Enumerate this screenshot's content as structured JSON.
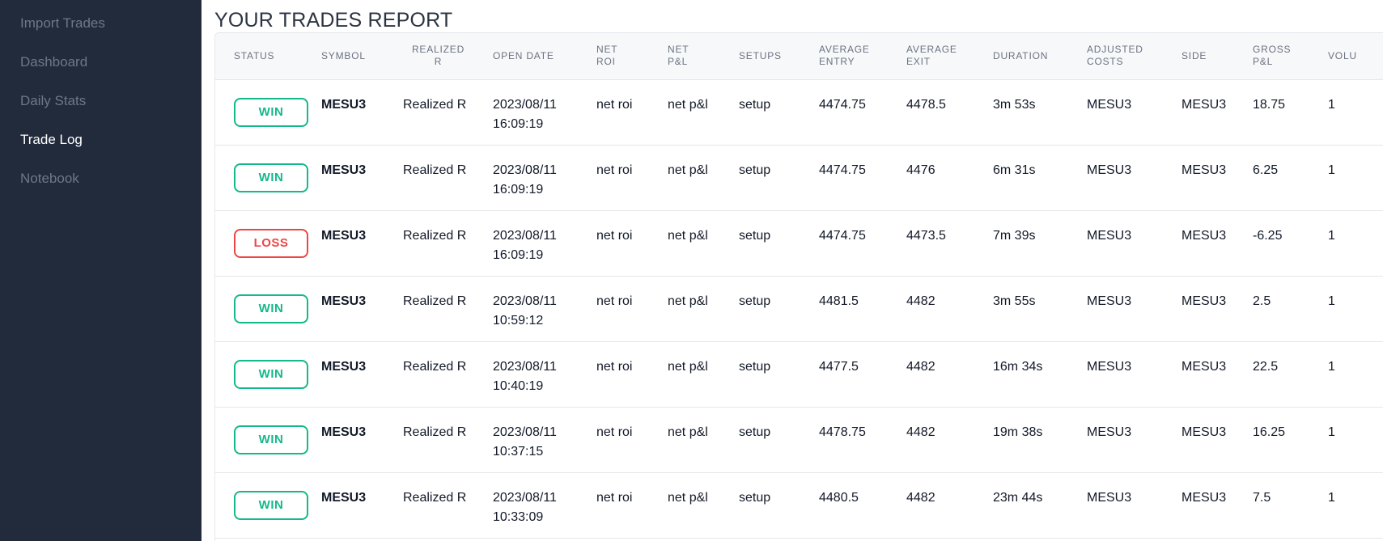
{
  "sidebar": {
    "items": [
      {
        "label": "Import Trades",
        "active": false
      },
      {
        "label": "Dashboard",
        "active": false
      },
      {
        "label": "Daily Stats",
        "active": false
      },
      {
        "label": "Trade Log",
        "active": true
      },
      {
        "label": "Notebook",
        "active": false
      }
    ]
  },
  "page": {
    "title": "YOUR TRADES REPORT"
  },
  "table": {
    "headers": {
      "status": "STATUS",
      "symbol": "SYMBOL",
      "realized_r_1": "REALIZED",
      "realized_r_2": "R",
      "open_date": "OPEN DATE",
      "net_roi_1": "NET",
      "net_roi_2": "ROI",
      "net_pl_1": "NET",
      "net_pl_2": "P&L",
      "setups": "SETUPS",
      "avg_entry_1": "AVERAGE",
      "avg_entry_2": "ENTRY",
      "avg_exit_1": "AVERAGE",
      "avg_exit_2": "EXIT",
      "duration": "DURATION",
      "adjusted_costs_1": "ADJUSTED",
      "adjusted_costs_2": "COSTS",
      "side": "SIDE",
      "gross_pl_1": "GROSS",
      "gross_pl_2": "P&L",
      "volume": "VOLU"
    },
    "rows": [
      {
        "status": "WIN",
        "symbol": "MESU3",
        "realized_r": "Realized R",
        "date": "2023/08/11",
        "time": "16:09:19",
        "net_roi": "net roi",
        "net_pl": "net p&l",
        "setup": "setup",
        "avg_entry": "4474.75",
        "avg_exit": "4478.5",
        "duration": "3m 53s",
        "adjusted_costs": "MESU3",
        "side": "MESU3",
        "gross_pl": "18.75",
        "volume": "1"
      },
      {
        "status": "WIN",
        "symbol": "MESU3",
        "realized_r": "Realized R",
        "date": "2023/08/11",
        "time": "16:09:19",
        "net_roi": "net roi",
        "net_pl": "net p&l",
        "setup": "setup",
        "avg_entry": "4474.75",
        "avg_exit": "4476",
        "duration": "6m 31s",
        "adjusted_costs": "MESU3",
        "side": "MESU3",
        "gross_pl": "6.25",
        "volume": "1"
      },
      {
        "status": "LOSS",
        "symbol": "MESU3",
        "realized_r": "Realized R",
        "date": "2023/08/11",
        "time": "16:09:19",
        "net_roi": "net roi",
        "net_pl": "net p&l",
        "setup": "setup",
        "avg_entry": "4474.75",
        "avg_exit": "4473.5",
        "duration": "7m 39s",
        "adjusted_costs": "MESU3",
        "side": "MESU3",
        "gross_pl": "-6.25",
        "volume": "1"
      },
      {
        "status": "WIN",
        "symbol": "MESU3",
        "realized_r": "Realized R",
        "date": "2023/08/11",
        "time": "10:59:12",
        "net_roi": "net roi",
        "net_pl": "net p&l",
        "setup": "setup",
        "avg_entry": "4481.5",
        "avg_exit": "4482",
        "duration": "3m 55s",
        "adjusted_costs": "MESU3",
        "side": "MESU3",
        "gross_pl": "2.5",
        "volume": "1"
      },
      {
        "status": "WIN",
        "symbol": "MESU3",
        "realized_r": "Realized R",
        "date": "2023/08/11",
        "time": "10:40:19",
        "net_roi": "net roi",
        "net_pl": "net p&l",
        "setup": "setup",
        "avg_entry": "4477.5",
        "avg_exit": "4482",
        "duration": "16m 34s",
        "adjusted_costs": "MESU3",
        "side": "MESU3",
        "gross_pl": "22.5",
        "volume": "1"
      },
      {
        "status": "WIN",
        "symbol": "MESU3",
        "realized_r": "Realized R",
        "date": "2023/08/11",
        "time": "10:37:15",
        "net_roi": "net roi",
        "net_pl": "net p&l",
        "setup": "setup",
        "avg_entry": "4478.75",
        "avg_exit": "4482",
        "duration": "19m 38s",
        "adjusted_costs": "MESU3",
        "side": "MESU3",
        "gross_pl": "16.25",
        "volume": "1"
      },
      {
        "status": "WIN",
        "symbol": "MESU3",
        "realized_r": "Realized R",
        "date": "2023/08/11",
        "time": "10:33:09",
        "net_roi": "net roi",
        "net_pl": "net p&l",
        "setup": "setup",
        "avg_entry": "4480.5",
        "avg_exit": "4482",
        "duration": "23m 44s",
        "adjusted_costs": "MESU3",
        "side": "MESU3",
        "gross_pl": "7.5",
        "volume": "1"
      }
    ]
  },
  "colors": {
    "sidebar_bg": "#222b3b",
    "win": "#14b88a",
    "loss": "#ef4444"
  }
}
